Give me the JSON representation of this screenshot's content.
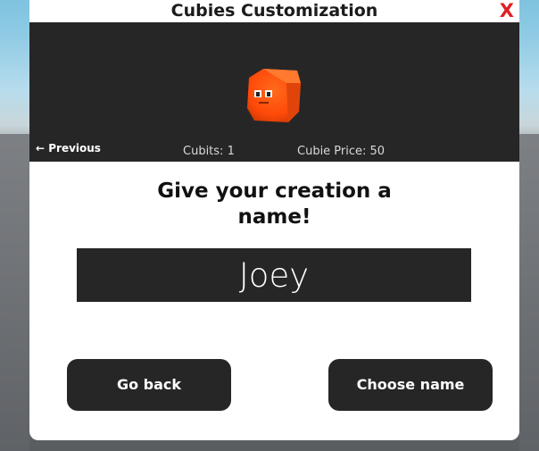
{
  "window": {
    "title": "Cubies Customization",
    "close_label": "X"
  },
  "preview": {
    "previous_label": "← Previous",
    "cubits_text": "Cubits: 1",
    "price_text": "Cubie Price: 50",
    "cube_icon": "orange-cube-character",
    "cube_color": "#ff4a0a"
  },
  "prompt": {
    "line1": "Give your creation a",
    "line2": "name!"
  },
  "name_input": {
    "value": "Joey"
  },
  "buttons": {
    "back_label": "Go back",
    "choose_label": "Choose name"
  }
}
